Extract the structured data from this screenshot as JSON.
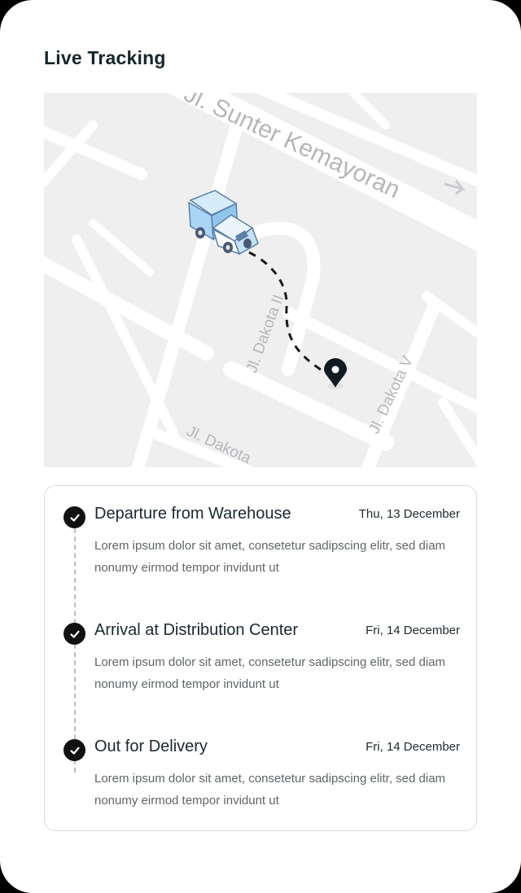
{
  "header": {
    "title": "Live Tracking"
  },
  "map": {
    "street_labels": [
      "Jl. Sunter Kemayoran",
      "Jl. Dakota II",
      "Jl. Dakota V",
      "Jl. Dakota"
    ],
    "vehicle_icon": "delivery-truck-icon",
    "destination_icon": "location-pin-icon"
  },
  "timeline": [
    {
      "title": "Departure from Warehouse",
      "date": "Thu, 13 December",
      "description": "Lorem ipsum dolor sit amet, consetetur sadipscing elitr, sed diam nonumy eirmod tempor invidunt ut"
    },
    {
      "title": "Arrival at Distribution Center",
      "date": "Fri, 14 December",
      "description": "Lorem ipsum dolor sit amet, consetetur sadipscing elitr, sed diam nonumy eirmod tempor invidunt ut"
    },
    {
      "title": "Out for Delivery",
      "date": "Fri, 14 December",
      "description": "Lorem ipsum dolor sit amet, consetetur sadipscing elitr, sed diam nonumy eirmod tempor invidunt ut"
    }
  ],
  "colors": {
    "background": "#000000",
    "card": "#ffffff",
    "map_base": "#efeff0",
    "map_road": "#ffffff",
    "text_primary": "#13262b",
    "text_secondary": "#5f6568",
    "check": "#111111",
    "truck": "#a9d6f5"
  }
}
